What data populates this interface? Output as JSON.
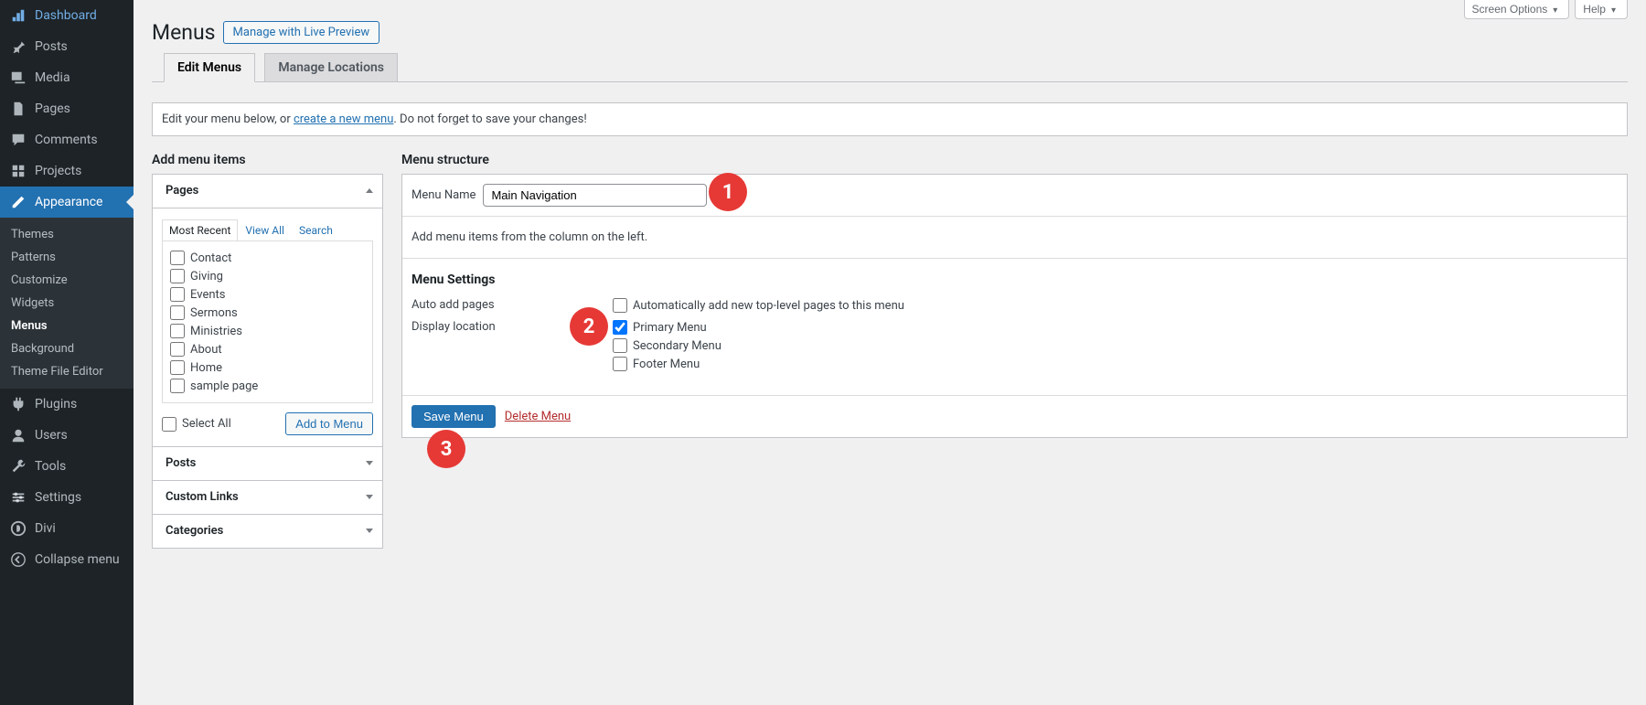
{
  "sidebar": {
    "items": [
      {
        "label": "Dashboard",
        "icon": "dashboard",
        "active": false
      },
      {
        "label": "Posts",
        "icon": "pin",
        "active": false
      },
      {
        "label": "Media",
        "icon": "media",
        "active": false
      },
      {
        "label": "Pages",
        "icon": "page",
        "active": false
      },
      {
        "label": "Comments",
        "icon": "comment",
        "active": false
      },
      {
        "label": "Projects",
        "icon": "projects",
        "active": false
      },
      {
        "label": "Appearance",
        "icon": "appearance",
        "active": true
      },
      {
        "label": "Plugins",
        "icon": "plugin",
        "active": false
      },
      {
        "label": "Users",
        "icon": "user",
        "active": false
      },
      {
        "label": "Tools",
        "icon": "tools",
        "active": false
      },
      {
        "label": "Settings",
        "icon": "settings",
        "active": false
      },
      {
        "label": "Divi",
        "icon": "divi",
        "active": false
      }
    ],
    "submenu": [
      "Themes",
      "Patterns",
      "Customize",
      "Widgets",
      "Menus",
      "Background",
      "Theme File Editor"
    ],
    "collapse_label": "Collapse menu"
  },
  "screen_meta": {
    "screen_options": "Screen Options",
    "help": "Help"
  },
  "heading": "Menus",
  "page_action": "Manage with Live Preview",
  "tabs": [
    "Edit Menus",
    "Manage Locations"
  ],
  "notice": {
    "pre": "Edit your menu below, or ",
    "link": "create a new menu",
    "post": ". Do not forget to save your changes!"
  },
  "add_items_title": "Add menu items",
  "structure_title": "Menu structure",
  "pages_panel": {
    "title": "Pages",
    "mini_tabs": [
      "Most Recent",
      "View All",
      "Search"
    ],
    "items": [
      "Contact",
      "Giving",
      "Events",
      "Sermons",
      "Ministries",
      "About",
      "Home",
      "sample page"
    ],
    "select_all": "Select All",
    "add_to_menu": "Add to Menu"
  },
  "collapsed_panels": [
    "Posts",
    "Custom Links",
    "Categories"
  ],
  "menu_name_label": "Menu Name",
  "menu_name_value": "Main Navigation",
  "empty_hint": "Add menu items from the column on the left.",
  "settings": {
    "title": "Menu Settings",
    "auto_label": "Auto add pages",
    "auto_checkbox": "Automatically add new top-level pages to this menu",
    "loc_label": "Display location",
    "locations": [
      {
        "label": "Primary Menu",
        "checked": true
      },
      {
        "label": "Secondary Menu",
        "checked": false
      },
      {
        "label": "Footer Menu",
        "checked": false
      }
    ]
  },
  "save_label": "Save Menu",
  "delete_label": "Delete Menu",
  "annot": {
    "a1": "1",
    "a2": "2",
    "a3": "3"
  }
}
